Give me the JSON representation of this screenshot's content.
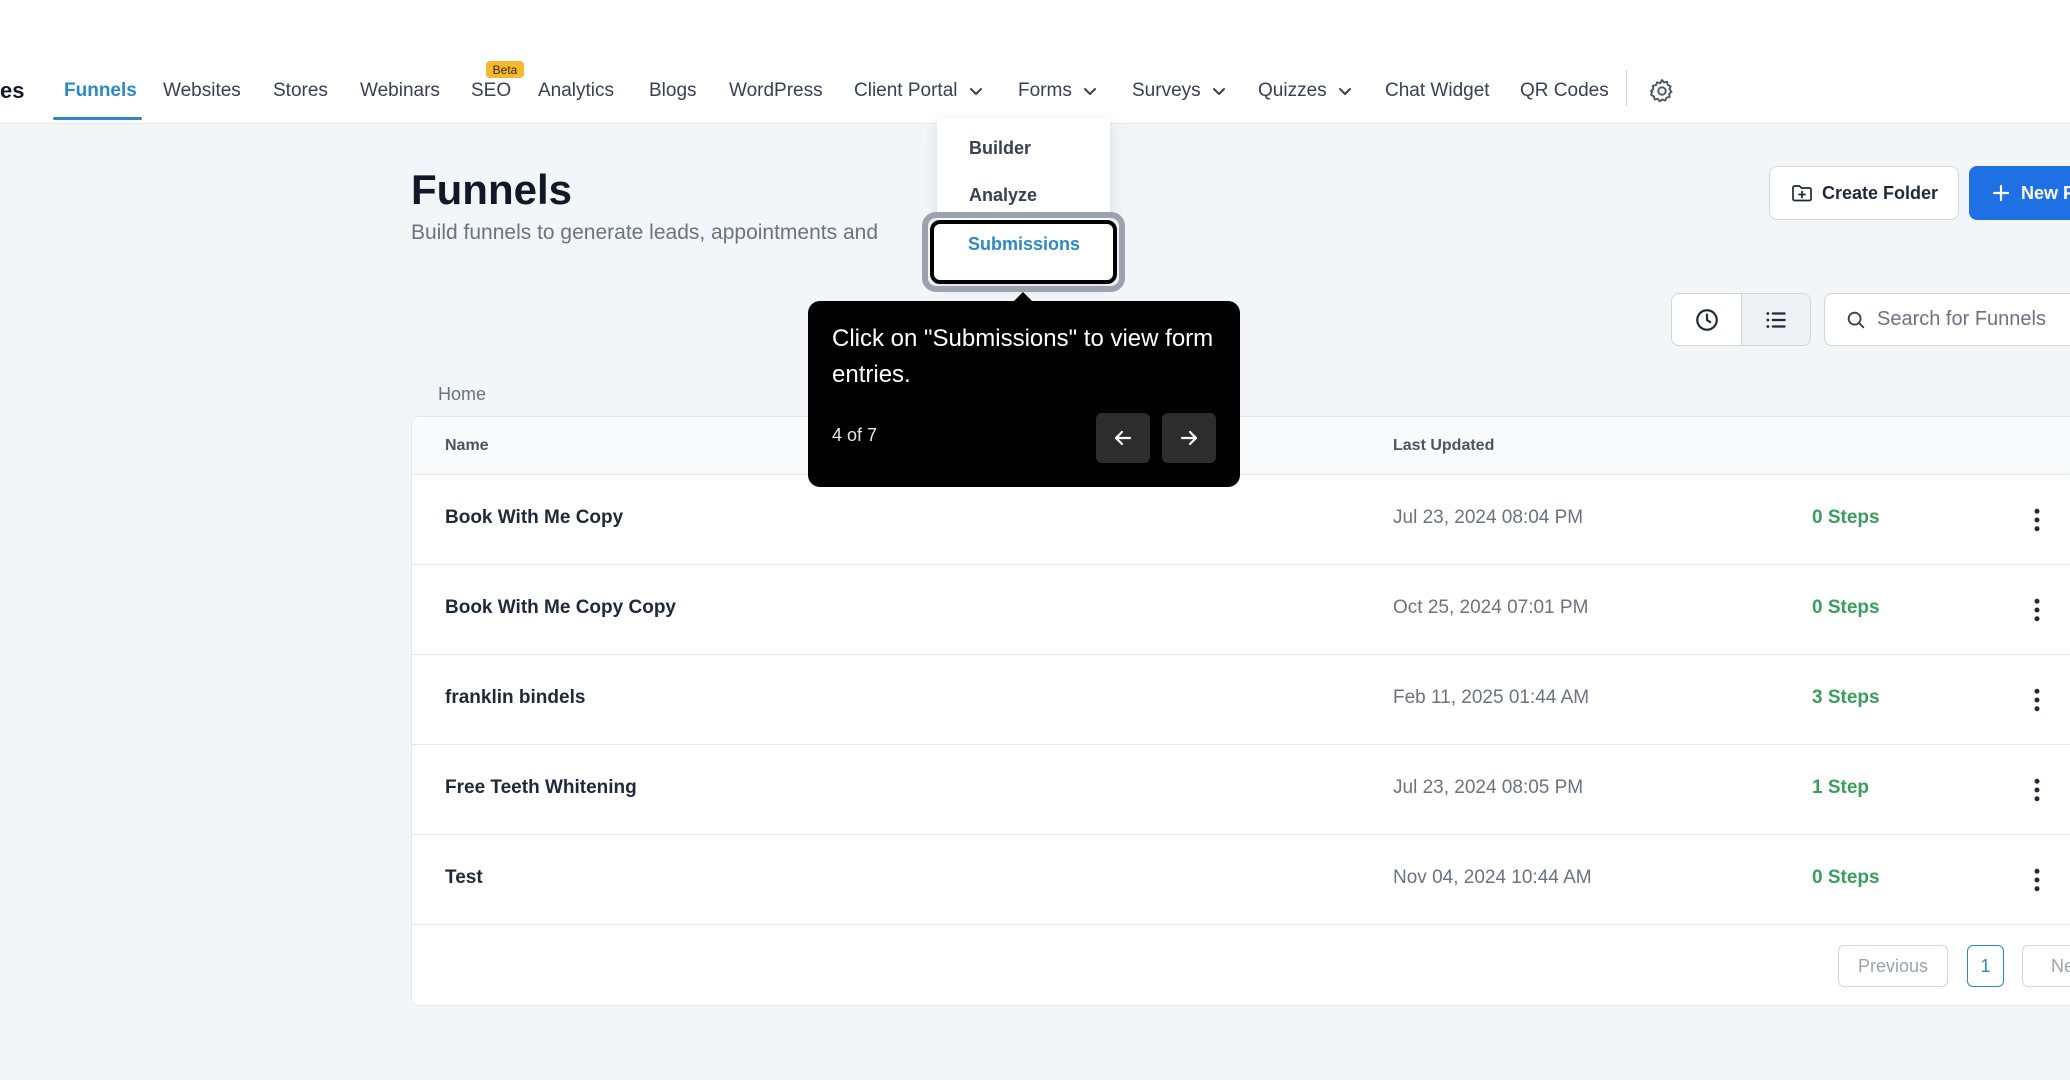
{
  "nav": {
    "partial_left": "es",
    "items": [
      {
        "label": "Funnels",
        "active": true
      },
      {
        "label": "Websites"
      },
      {
        "label": "Stores"
      },
      {
        "label": "Webinars"
      },
      {
        "label": "SEO",
        "badge": "Beta"
      },
      {
        "label": "Analytics"
      },
      {
        "label": "Blogs"
      },
      {
        "label": "WordPress"
      },
      {
        "label": "Client Portal",
        "dropdown": true
      },
      {
        "label": "Forms",
        "dropdown": true
      },
      {
        "label": "Surveys",
        "dropdown": true
      },
      {
        "label": "Quizzes",
        "dropdown": true
      },
      {
        "label": "Chat Widget"
      },
      {
        "label": "QR Codes"
      }
    ],
    "settings_icon": "gear-icon"
  },
  "forms_menu": {
    "items": [
      "Builder",
      "Analyze",
      "Submissions"
    ],
    "highlighted": "Submissions"
  },
  "page": {
    "title": "Funnels",
    "subtitle": "Build funnels to generate leads, appointments and",
    "create_folder_label": "Create Folder",
    "new_label": "New F",
    "search_placeholder": "Search for Funnels",
    "breadcrumb": "Home"
  },
  "table": {
    "columns": [
      "Name",
      "Last Updated"
    ],
    "rows": [
      {
        "name": "Book With Me Copy",
        "updated": "Jul 23, 2024 08:04 PM",
        "steps": "0 Steps"
      },
      {
        "name": "Book With Me Copy Copy",
        "updated": "Oct 25, 2024 07:01 PM",
        "steps": "0 Steps"
      },
      {
        "name": "franklin bindels",
        "updated": "Feb 11, 2025 01:44 AM",
        "steps": "3 Steps"
      },
      {
        "name": "Free Teeth Whitening",
        "updated": "Jul 23, 2024 08:05 PM",
        "steps": "1 Step"
      },
      {
        "name": "Test",
        "updated": "Nov 04, 2024 10:44 AM",
        "steps": "0 Steps"
      }
    ]
  },
  "pagination": {
    "previous": "Previous",
    "current": "1",
    "next": "Nex"
  },
  "tooltip": {
    "text": "Click on \"Submissions\" to view form entries.",
    "progress": "4 of 7"
  },
  "colors": {
    "accent": "#2a89c6",
    "primary_button": "#1f6fe5",
    "steps_green": "#3a9e5c",
    "beta_badge": "#f5b82e"
  }
}
